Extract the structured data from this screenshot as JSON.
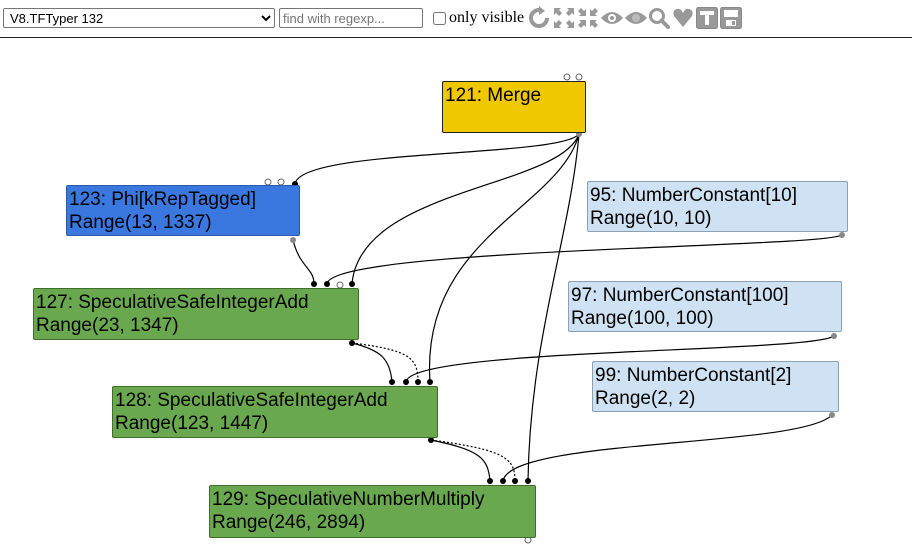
{
  "toolbar": {
    "phase_selected": "V8.TFTyper 132",
    "search_placeholder": "find with regexp...",
    "only_visible_label": "only visible",
    "icons": [
      "reload-icon",
      "expand-icon",
      "fit-icon",
      "eye-icon",
      "eye-hidden-icon",
      "search-icon",
      "heart-icon",
      "text-toggle-icon",
      "save-icon"
    ]
  },
  "nodes": {
    "n121": {
      "label": "121: Merge",
      "range": ""
    },
    "n123": {
      "label": "123: Phi[kRepTagged]",
      "range": "Range(13, 1337)"
    },
    "n95": {
      "label": "95: NumberConstant[10]",
      "range": "Range(10, 10)"
    },
    "n127": {
      "label": "127: SpeculativeSafeIntegerAdd",
      "range": "Range(23, 1347)"
    },
    "n97": {
      "label": "97: NumberConstant[100]",
      "range": "Range(100, 100)"
    },
    "n128": {
      "label": "128: SpeculativeSafeIntegerAdd",
      "range": "Range(123, 1447)"
    },
    "n99": {
      "label": "99: NumberConstant[2]",
      "range": "Range(2, 2)"
    },
    "n129": {
      "label": "129: SpeculativeNumberMultiply",
      "range": "Range(246, 2894)"
    }
  },
  "colors": {
    "merge": "#f0c800",
    "phi": "#3a78e0",
    "speculative": "#6aa84f",
    "constant": "#cfe2f3"
  }
}
